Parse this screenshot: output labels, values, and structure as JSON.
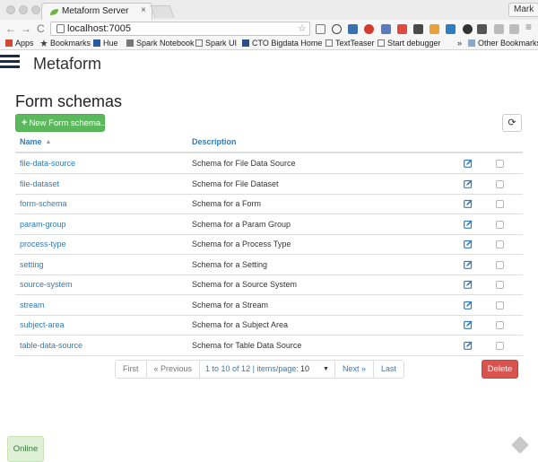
{
  "browser": {
    "tab_title": "Metaform Server",
    "tab_close": "×",
    "url": "localhost:7005",
    "profile_name": "Mark",
    "nav": {
      "back": "←",
      "forward": "→",
      "reload": "C",
      "star": "☆"
    },
    "bookmarks": {
      "apps": "Apps",
      "items": [
        "Bookmarks",
        "Hue",
        "Spark Notebook",
        "Spark UI",
        "CTO Bigdata Home",
        "TextTeaser",
        "Start debugger"
      ],
      "more": "»",
      "other": "Other Bookmarks"
    }
  },
  "app": {
    "title": "Metaform",
    "page_title": "Form schemas",
    "new_button": "New Form schema...",
    "new_button_icon": "+",
    "refresh_icon": "⟳"
  },
  "table": {
    "columns": {
      "name": "Name",
      "description": "Description"
    },
    "sort_indicator": "▲",
    "rows": [
      {
        "name": "file-data-source",
        "description": "Schema for File Data Source"
      },
      {
        "name": "file-dataset",
        "description": "Schema for File Dataset"
      },
      {
        "name": "form-schema",
        "description": "Schema for a Form"
      },
      {
        "name": "param-group",
        "description": "Schema for a Param Group"
      },
      {
        "name": "process-type",
        "description": "Schema for a Process Type"
      },
      {
        "name": "setting",
        "description": "Schema for a Setting"
      },
      {
        "name": "source-system",
        "description": "Schema for a Source System"
      },
      {
        "name": "stream",
        "description": "Schema for a Stream"
      },
      {
        "name": "subject-area",
        "description": "Schema for a Subject Area"
      },
      {
        "name": "table-data-source",
        "description": "Schema for Table Data Source"
      }
    ]
  },
  "pagination": {
    "first": "First",
    "previous": "« Previous",
    "info": "1 to 10 of 12 | items/page:",
    "page_size": "10",
    "next": "Next »",
    "last": "Last"
  },
  "actions": {
    "delete": "Delete"
  },
  "status": {
    "online": "Online"
  },
  "colors": {
    "primary_link": "#337ab7",
    "success": "#5cb85c",
    "danger": "#d9534f",
    "brand_dark": "#1b2b48",
    "online_bg": "#dff0d8"
  }
}
